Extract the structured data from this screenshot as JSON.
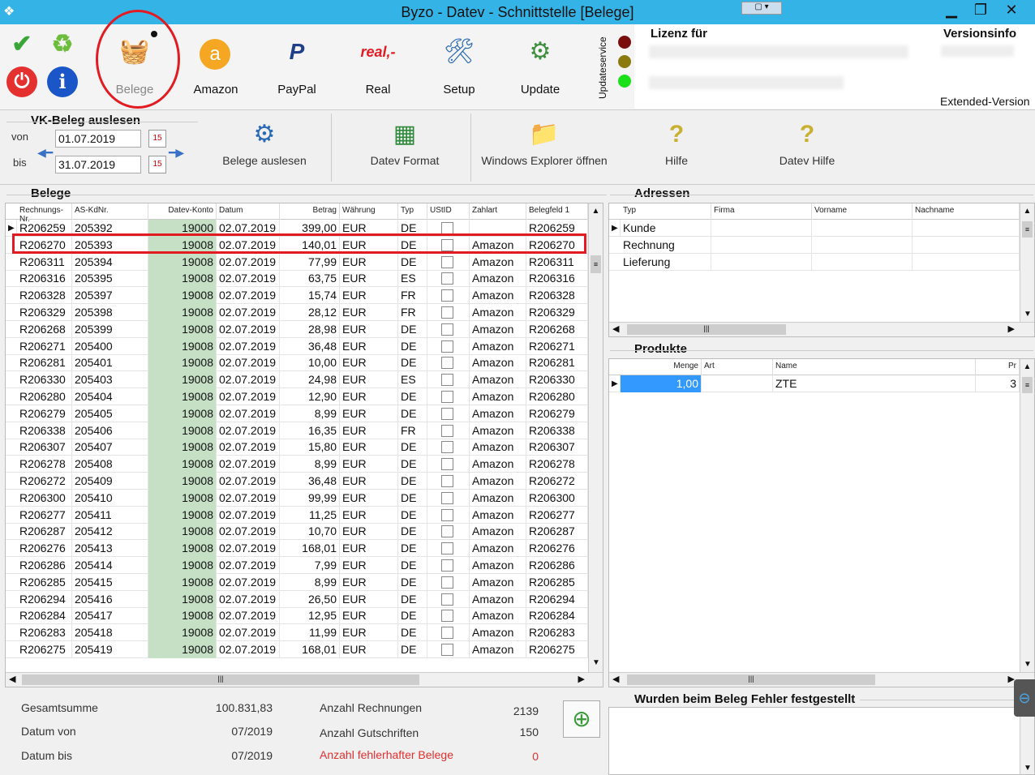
{
  "window": {
    "title": "Byzo - Datev - Schnittstelle [Belege]",
    "minimize": "▁",
    "maximize": "❐",
    "close": "✕"
  },
  "toolbar": {
    "buttons": [
      {
        "label": "Belege",
        "icon": "basket-search-icon"
      },
      {
        "label": "Amazon",
        "icon": "amazon-icon"
      },
      {
        "label": "PayPal",
        "icon": "paypal-icon"
      },
      {
        "label": "Real",
        "icon": "real-icon"
      },
      {
        "label": "Setup",
        "icon": "setup-icon"
      },
      {
        "label": "Update",
        "icon": "update-icon"
      }
    ],
    "updateservice": "Updateservice",
    "lizenz": "Lizenz für",
    "versionsinfo": "Versionsinfo",
    "extended": "Extended-Version"
  },
  "vk": {
    "title": "VK-Beleg auslesen",
    "von_label": "von",
    "bis_label": "bis",
    "von": "01.07.2019",
    "bis": "31.07.2019",
    "cal": "15"
  },
  "actions": [
    {
      "label": "Belege auslesen",
      "icon": "gears-icon"
    },
    {
      "label": "Datev Format",
      "icon": "csv-icon"
    },
    {
      "label": "Windows Explorer öffnen",
      "icon": "folder-icon"
    },
    {
      "label": "Hilfe",
      "icon": "help-icon"
    },
    {
      "label": "Datev Hilfe",
      "icon": "help-icon"
    }
  ],
  "belege": {
    "title": "Belege",
    "columns": [
      "Rechnungs-Nr.",
      "AS-KdNr.",
      "Datev-Konto",
      "Datum",
      "Betrag",
      "Währung",
      "Typ",
      "UStID",
      "Zahlart",
      "Belegfeld 1"
    ],
    "rows": [
      [
        "R206259",
        "205392",
        "19000",
        "02.07.2019",
        "399,00",
        "EUR",
        "DE",
        "",
        "",
        "R206259"
      ],
      [
        "R206270",
        "205393",
        "19008",
        "02.07.2019",
        "140,01",
        "EUR",
        "DE",
        "",
        "Amazon",
        "R206270"
      ],
      [
        "R206311",
        "205394",
        "19008",
        "02.07.2019",
        "77,99",
        "EUR",
        "DE",
        "",
        "Amazon",
        "R206311"
      ],
      [
        "R206316",
        "205395",
        "19008",
        "02.07.2019",
        "63,75",
        "EUR",
        "ES",
        "",
        "Amazon",
        "R206316"
      ],
      [
        "R206328",
        "205397",
        "19008",
        "02.07.2019",
        "15,74",
        "EUR",
        "FR",
        "",
        "Amazon",
        "R206328"
      ],
      [
        "R206329",
        "205398",
        "19008",
        "02.07.2019",
        "28,12",
        "EUR",
        "FR",
        "",
        "Amazon",
        "R206329"
      ],
      [
        "R206268",
        "205399",
        "19008",
        "02.07.2019",
        "28,98",
        "EUR",
        "DE",
        "",
        "Amazon",
        "R206268"
      ],
      [
        "R206271",
        "205400",
        "19008",
        "02.07.2019",
        "36,48",
        "EUR",
        "DE",
        "",
        "Amazon",
        "R206271"
      ],
      [
        "R206281",
        "205401",
        "19008",
        "02.07.2019",
        "10,00",
        "EUR",
        "DE",
        "",
        "Amazon",
        "R206281"
      ],
      [
        "R206330",
        "205403",
        "19008",
        "02.07.2019",
        "24,98",
        "EUR",
        "ES",
        "",
        "Amazon",
        "R206330"
      ],
      [
        "R206280",
        "205404",
        "19008",
        "02.07.2019",
        "12,90",
        "EUR",
        "DE",
        "",
        "Amazon",
        "R206280"
      ],
      [
        "R206279",
        "205405",
        "19008",
        "02.07.2019",
        "8,99",
        "EUR",
        "DE",
        "",
        "Amazon",
        "R206279"
      ],
      [
        "R206338",
        "205406",
        "19008",
        "02.07.2019",
        "16,35",
        "EUR",
        "FR",
        "",
        "Amazon",
        "R206338"
      ],
      [
        "R206307",
        "205407",
        "19008",
        "02.07.2019",
        "15,80",
        "EUR",
        "DE",
        "",
        "Amazon",
        "R206307"
      ],
      [
        "R206278",
        "205408",
        "19008",
        "02.07.2019",
        "8,99",
        "EUR",
        "DE",
        "",
        "Amazon",
        "R206278"
      ],
      [
        "R206272",
        "205409",
        "19008",
        "02.07.2019",
        "36,48",
        "EUR",
        "DE",
        "",
        "Amazon",
        "R206272"
      ],
      [
        "R206300",
        "205410",
        "19008",
        "02.07.2019",
        "99,99",
        "EUR",
        "DE",
        "",
        "Amazon",
        "R206300"
      ],
      [
        "R206277",
        "205411",
        "19008",
        "02.07.2019",
        "11,25",
        "EUR",
        "DE",
        "",
        "Amazon",
        "R206277"
      ],
      [
        "R206287",
        "205412",
        "19008",
        "02.07.2019",
        "10,70",
        "EUR",
        "DE",
        "",
        "Amazon",
        "R206287"
      ],
      [
        "R206276",
        "205413",
        "19008",
        "02.07.2019",
        "168,01",
        "EUR",
        "DE",
        "",
        "Amazon",
        "R206276"
      ],
      [
        "R206286",
        "205414",
        "19008",
        "02.07.2019",
        "7,99",
        "EUR",
        "DE",
        "",
        "Amazon",
        "R206286"
      ],
      [
        "R206285",
        "205415",
        "19008",
        "02.07.2019",
        "8,99",
        "EUR",
        "DE",
        "",
        "Amazon",
        "R206285"
      ],
      [
        "R206294",
        "205416",
        "19008",
        "02.07.2019",
        "26,50",
        "EUR",
        "DE",
        "",
        "Amazon",
        "R206294"
      ],
      [
        "R206284",
        "205417",
        "19008",
        "02.07.2019",
        "12,95",
        "EUR",
        "DE",
        "",
        "Amazon",
        "R206284"
      ],
      [
        "R206283",
        "205418",
        "19008",
        "02.07.2019",
        "11,99",
        "EUR",
        "DE",
        "",
        "Amazon",
        "R206283"
      ],
      [
        "R206275",
        "205419",
        "19008",
        "02.07.2019",
        "168,01",
        "EUR",
        "DE",
        "",
        "Amazon",
        "R206275"
      ]
    ]
  },
  "adressen": {
    "title": "Adressen",
    "columns": [
      "Typ",
      "Firma",
      "Vorname",
      "Nachname"
    ],
    "rows": [
      "Kunde",
      "Rechnung",
      "Lieferung"
    ]
  },
  "produkte": {
    "title": "Produkte",
    "columns": [
      "Menge",
      "Art",
      "Name",
      "Pr"
    ],
    "row": {
      "menge": "1,00",
      "art": "",
      "name": "ZTE",
      "pr": "3"
    }
  },
  "summary": {
    "gesamtsumme_label": "Gesamtsumme",
    "gesamtsumme": "100.831,83",
    "datum_von_label": "Datum von",
    "datum_von": "07/2019",
    "datum_bis_label": "Datum bis",
    "datum_bis": "07/2019",
    "anz_rech_label": "Anzahl Rechnungen",
    "anz_rech": "2139",
    "anz_gut_label": "Anzahl Gutschriften",
    "anz_gut": "150",
    "anz_fehl_label": "Anzahl fehlerhafter Belege",
    "anz_fehl": "0"
  },
  "fehler": {
    "title": "Wurden beim Beleg Fehler festgestellt"
  },
  "colors": {
    "titlebar": "#34b4e6",
    "highlight": "#e21b23",
    "konto_bg": "#c5e0c5",
    "selected_qty": "#3399ff"
  }
}
